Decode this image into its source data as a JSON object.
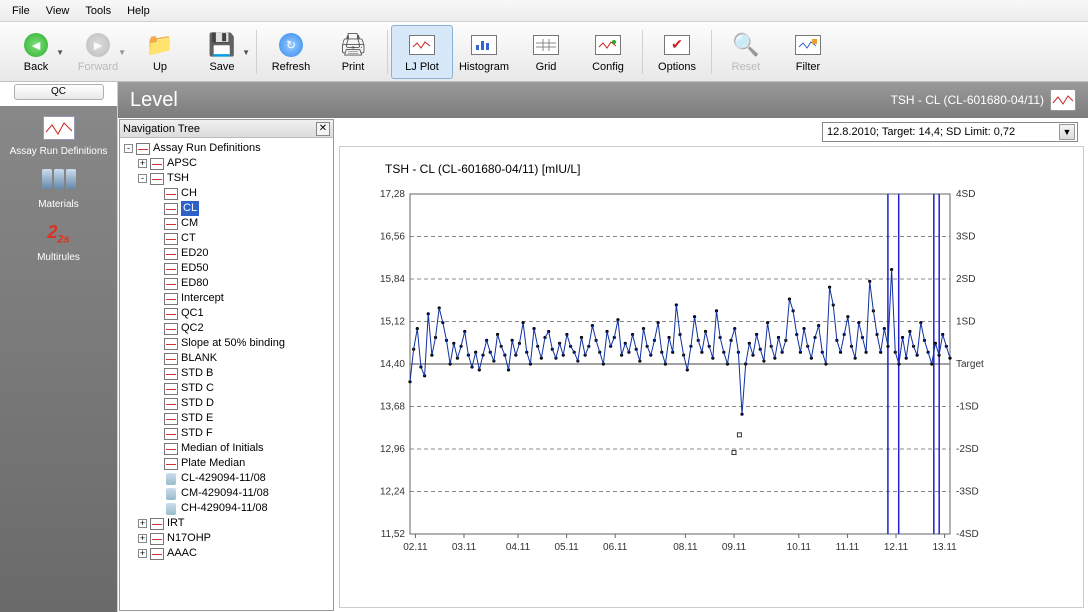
{
  "menu": {
    "items": [
      "File",
      "View",
      "Tools",
      "Help"
    ]
  },
  "toolbar": {
    "back": "Back",
    "forward": "Forward",
    "up": "Up",
    "save": "Save",
    "refresh": "Refresh",
    "print": "Print",
    "ljplot": "LJ Plot",
    "histogram": "Histogram",
    "grid": "Grid",
    "config": "Config",
    "options": "Options",
    "reset": "Reset",
    "filter": "Filter"
  },
  "leftbar": {
    "header": "QC",
    "items": [
      {
        "label": "Assay Run Definitions",
        "icon": "assay-icon"
      },
      {
        "label": "Materials",
        "icon": "materials-icon"
      },
      {
        "label": "Multirules",
        "icon": "multirules-icon"
      }
    ]
  },
  "titlebar": {
    "left": "Level",
    "right": "TSH - CL (CL-601680-04/11)"
  },
  "navtree": {
    "title": "Navigation Tree",
    "root": "Assay Run Definitions",
    "nodes": [
      {
        "label": "APSC",
        "box": "+",
        "ind": 1,
        "icon": "w"
      },
      {
        "label": "TSH",
        "box": "-",
        "ind": 1,
        "icon": "w"
      },
      {
        "label": "CH",
        "ind": 2,
        "icon": "w"
      },
      {
        "label": "CL",
        "ind": 2,
        "icon": "w",
        "sel": true
      },
      {
        "label": "CM",
        "ind": 2,
        "icon": "w"
      },
      {
        "label": "CT",
        "ind": 2,
        "icon": "w"
      },
      {
        "label": "ED20",
        "ind": 2,
        "icon": "w"
      },
      {
        "label": "ED50",
        "ind": 2,
        "icon": "w"
      },
      {
        "label": "ED80",
        "ind": 2,
        "icon": "w"
      },
      {
        "label": "Intercept",
        "ind": 2,
        "icon": "w"
      },
      {
        "label": "QC1",
        "ind": 2,
        "icon": "w"
      },
      {
        "label": "QC2",
        "ind": 2,
        "icon": "w"
      },
      {
        "label": "Slope at 50% binding",
        "ind": 2,
        "icon": "w"
      },
      {
        "label": "BLANK",
        "ind": 2,
        "icon": "w"
      },
      {
        "label": "STD B",
        "ind": 2,
        "icon": "w"
      },
      {
        "label": "STD C",
        "ind": 2,
        "icon": "w"
      },
      {
        "label": "STD D",
        "ind": 2,
        "icon": "w"
      },
      {
        "label": "STD E",
        "ind": 2,
        "icon": "w"
      },
      {
        "label": "STD F",
        "ind": 2,
        "icon": "w"
      },
      {
        "label": "Median of Initials",
        "ind": 2,
        "icon": "w"
      },
      {
        "label": "Plate Median",
        "ind": 2,
        "icon": "w"
      },
      {
        "label": "CL-429094-11/08",
        "ind": 2,
        "icon": "b"
      },
      {
        "label": "CM-429094-11/08",
        "ind": 2,
        "icon": "b"
      },
      {
        "label": "CH-429094-11/08",
        "ind": 2,
        "icon": "b"
      },
      {
        "label": "IRT",
        "box": "+",
        "ind": 1,
        "icon": "w"
      },
      {
        "label": "N17OHP",
        "box": "+",
        "ind": 1,
        "icon": "w"
      },
      {
        "label": "AAAC",
        "box": "+",
        "ind": 1,
        "icon": "w"
      }
    ]
  },
  "selector": {
    "text": "12.8.2010; Target: 14,4; SD Limit: 0,72"
  },
  "chart_data": {
    "type": "line",
    "title": "TSH - CL (CL-601680-04/11) [mIU/L]",
    "xlabel": "",
    "ylabel": "",
    "ylim": [
      11.52,
      17.28
    ],
    "target": 14.4,
    "sd": 0.72,
    "y_ticks": [
      11.52,
      12.24,
      12.96,
      13.68,
      14.4,
      15.12,
      15.84,
      16.56,
      17.28
    ],
    "sd_labels": [
      "-4SD",
      "-3SD",
      "-2SD",
      "-1SD",
      "Target",
      "1SD",
      "2SD",
      "3SD",
      "4SD"
    ],
    "x_ticks": [
      "02.11",
      "03.11",
      "04.11",
      "05.11",
      "06.11",
      "08.11",
      "09.11",
      "10.11",
      "11.11",
      "12.11",
      "13.11"
    ],
    "x_tick_positions": [
      0.01,
      0.1,
      0.2,
      0.29,
      0.38,
      0.51,
      0.6,
      0.72,
      0.81,
      0.9,
      0.99
    ],
    "violation_bands": [
      [
        0.885,
        0.905
      ],
      [
        0.97,
        0.98
      ]
    ],
    "outliers": [
      [
        0.6,
        12.9
      ],
      [
        0.61,
        13.2
      ]
    ],
    "values": [
      14.1,
      14.65,
      15.0,
      14.35,
      14.2,
      15.25,
      14.55,
      14.85,
      15.35,
      15.1,
      14.8,
      14.4,
      14.75,
      14.5,
      14.7,
      14.95,
      14.55,
      14.35,
      14.6,
      14.3,
      14.55,
      14.8,
      14.6,
      14.45,
      14.9,
      14.7,
      14.55,
      14.3,
      14.8,
      14.55,
      14.75,
      15.1,
      14.6,
      14.4,
      15.0,
      14.7,
      14.5,
      14.85,
      14.95,
      14.65,
      14.5,
      14.75,
      14.55,
      14.9,
      14.7,
      14.6,
      14.45,
      14.85,
      14.55,
      14.7,
      15.05,
      14.8,
      14.6,
      14.4,
      14.95,
      14.7,
      14.85,
      15.15,
      14.55,
      14.75,
      14.6,
      14.9,
      14.65,
      14.45,
      15.0,
      14.7,
      14.55,
      14.8,
      15.1,
      14.6,
      14.4,
      14.85,
      14.6,
      15.4,
      14.9,
      14.55,
      14.3,
      14.7,
      15.2,
      14.8,
      14.6,
      14.95,
      14.7,
      14.5,
      15.3,
      14.85,
      14.6,
      14.4,
      14.8,
      15.0,
      14.6,
      13.55,
      14.4,
      14.75,
      14.55,
      14.9,
      14.65,
      14.45,
      15.1,
      14.7,
      14.5,
      14.85,
      14.6,
      14.8,
      15.5,
      15.3,
      14.9,
      14.6,
      15.0,
      14.7,
      14.5,
      14.85,
      15.05,
      14.6,
      14.4,
      15.7,
      15.4,
      14.8,
      14.6,
      14.9,
      15.2,
      14.7,
      14.5,
      15.1,
      14.85,
      14.6,
      15.8,
      15.3,
      14.9,
      14.6,
      15.0,
      14.7,
      16.0,
      14.6,
      14.4,
      14.85,
      14.5,
      14.95,
      14.7,
      14.55,
      15.1,
      14.8,
      14.6,
      14.4,
      14.75,
      14.55,
      14.9,
      14.7,
      14.5
    ]
  }
}
